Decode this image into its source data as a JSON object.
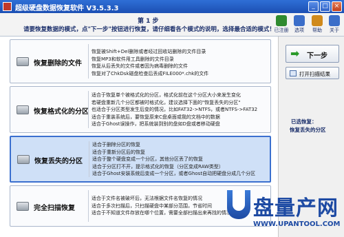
{
  "window": {
    "title": "超级硬盘数据恢复软件 V3.5.3.3",
    "minimize": "_",
    "maximize": "□",
    "close": "×"
  },
  "header": {
    "step_title": "第 1 步",
    "step_desc": "请要恢复数据的模式，点\"下一步\"按钮进行恢复，请仔细看各个模式的说明，选择最合适的模式！"
  },
  "toolbar": [
    {
      "label": "已注册",
      "color": "#2f8a2f"
    },
    {
      "label": "选项",
      "color": "#3b6ec9"
    },
    {
      "label": "帮助",
      "color": "#d08a1c"
    },
    {
      "label": "关于",
      "color": "#3b6ec9"
    }
  ],
  "modes": [
    {
      "name": "恢复删除的文件",
      "lines": [
        "恢复被Shift+Del删除或者经过回收站删除的文件目录",
        "恢复MP3和软件用工具删除的文件目录",
        "恢复从后丢失的文件或者因为病毒删除的文件",
        "恢复对了ChkDsk磁盘检查后丢成FILE000*.chk的文件"
      ]
    },
    {
      "name": "恢复格式化的分区",
      "lines": [
        "适合于恢复单个被格式化的分区，格式化前在这个分区大小来发生变化",
        "若硬盘重新几个分区都被时格式化，建议选择下面的\"恢复丢失的分区\"",
        "也适合于分区类型发生后变的情况，比如FAT32->NTFS，或者NTFS->FAT32",
        "适合于重装系统后，要恢复原来C盘桌面或我的文档中的数据",
        "适合于Ghost误操作，把系统装到别的盘如D盘或者移动硬盘"
      ]
    },
    {
      "name": "恢复丢失的分区",
      "lines": [
        "适合于删除分区的恢复",
        "适合于重新分区后的恢复",
        "适合于整个硬盘变成一个分区，其他分区丢了的恢复",
        "适合于分区打不开，提示格式化的恢复（分区变成RAW类型）",
        "适合于Ghost安装系统后变成一个分区，或者Ghost自动把硬盘分成几个分区"
      ]
    },
    {
      "name": "完全扫描恢复",
      "lines": [
        "适合于文件名被破坏后，无法根据文件名恢复的情况",
        "适合于多次扫描后，只扫描硬盘中某部分范围，节省时间",
        "适合于不知道文件存放在哪个位置，需要全部扫描出来再找的情况"
      ]
    }
  ],
  "selected_index": 2,
  "side": {
    "next_label": "下一步",
    "open_label": "打开扫描结果",
    "selected_label": "已选恢复：",
    "selected_value": "恢复丢失的分区"
  },
  "watermark": {
    "text": "盘量产网",
    "url": "WWW.UPANTOOL.COM"
  }
}
